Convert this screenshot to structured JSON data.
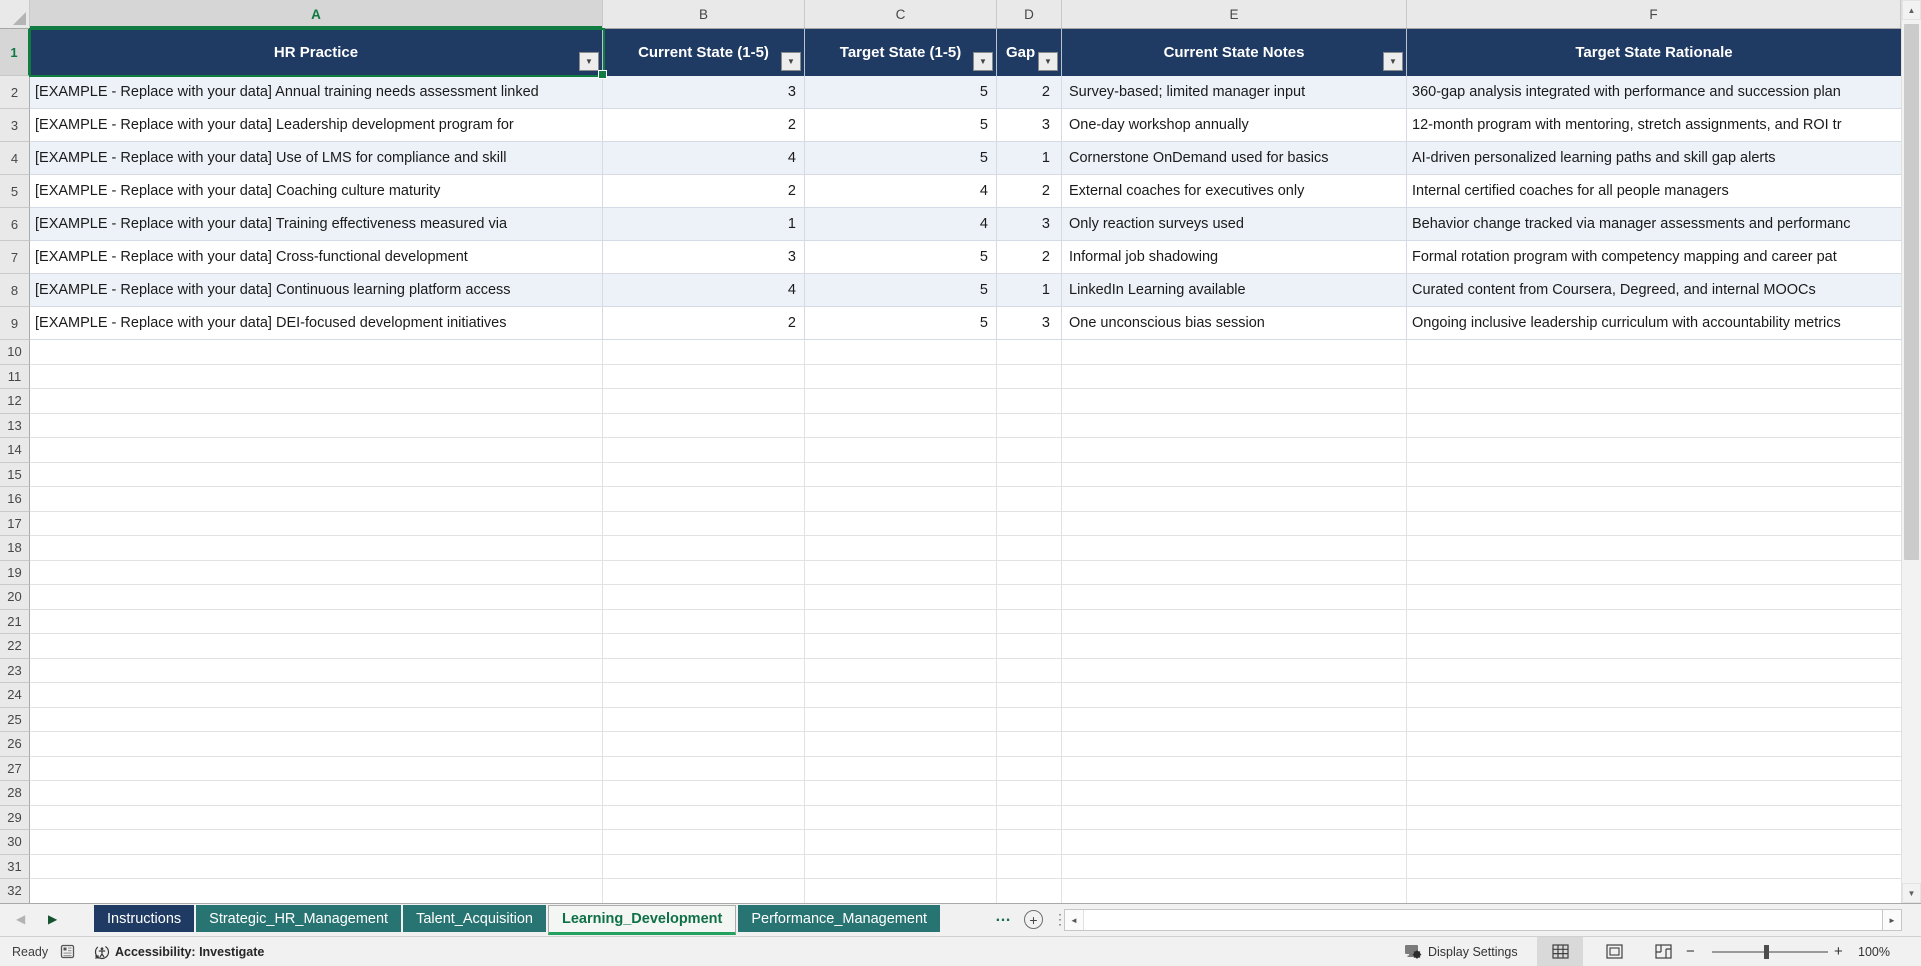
{
  "grid": {
    "column_letters": [
      "A",
      "B",
      "C",
      "D",
      "E",
      "F"
    ],
    "selected_column": "A",
    "selected_row": "1",
    "row_numbers": [
      "1",
      "2",
      "3",
      "4",
      "5",
      "6",
      "7",
      "8",
      "9",
      "10",
      "11",
      "12",
      "13",
      "14",
      "15",
      "16",
      "17",
      "18",
      "19",
      "20",
      "21",
      "22",
      "23",
      "24",
      "25",
      "26",
      "27",
      "28",
      "29",
      "30",
      "31",
      "32"
    ]
  },
  "table": {
    "headers": [
      {
        "label": "HR Practice",
        "filter": true
      },
      {
        "label": "Current State (1-5)",
        "filter": true
      },
      {
        "label": "Target State (1-5)",
        "filter": true
      },
      {
        "label": "Gap",
        "filter": true
      },
      {
        "label": "Current State Notes",
        "filter": true
      },
      {
        "label": "Target State Rationale",
        "filter": false
      }
    ],
    "rows": [
      {
        "practice": "[EXAMPLE - Replace with your data] Annual training needs assessment linked",
        "current": "3",
        "target": "5",
        "gap": "2",
        "notes": "Survey-based; limited manager input",
        "rationale": "360-gap analysis integrated with performance and succession plan"
      },
      {
        "practice": "[EXAMPLE - Replace with your data] Leadership development program for",
        "current": "2",
        "target": "5",
        "gap": "3",
        "notes": "One-day workshop annually",
        "rationale": "12-month program with mentoring, stretch assignments, and ROI tr"
      },
      {
        "practice": "[EXAMPLE - Replace with your data] Use of LMS for compliance and skill",
        "current": "4",
        "target": "5",
        "gap": "1",
        "notes": "Cornerstone OnDemand used for basics",
        "rationale": "AI-driven personalized learning paths and skill gap alerts"
      },
      {
        "practice": "[EXAMPLE - Replace with your data] Coaching culture maturity",
        "current": "2",
        "target": "4",
        "gap": "2",
        "notes": "External coaches for executives only",
        "rationale": "Internal certified coaches for all people managers"
      },
      {
        "practice": "[EXAMPLE - Replace with your data] Training effectiveness measured via",
        "current": "1",
        "target": "4",
        "gap": "3",
        "notes": "Only reaction surveys used",
        "rationale": "Behavior change tracked via manager assessments and performanc"
      },
      {
        "practice": "[EXAMPLE - Replace with your data] Cross-functional development",
        "current": "3",
        "target": "5",
        "gap": "2",
        "notes": "Informal job shadowing",
        "rationale": "Formal rotation program with competency mapping and career pat"
      },
      {
        "practice": "[EXAMPLE - Replace with your data] Continuous learning platform access",
        "current": "4",
        "target": "5",
        "gap": "1",
        "notes": "LinkedIn Learning available",
        "rationale": "Curated content from Coursera, Degreed, and internal MOOCs"
      },
      {
        "practice": "[EXAMPLE - Replace with your data] DEI-focused development initiatives",
        "current": "2",
        "target": "5",
        "gap": "3",
        "notes": "One unconscious bias session",
        "rationale": "Ongoing inclusive leadership curriculum with accountability metrics"
      }
    ]
  },
  "tab_bar": {
    "tabs": [
      {
        "label": "Instructions",
        "style": "navy",
        "active": false
      },
      {
        "label": "Strategic_HR_Management",
        "style": "teal",
        "active": false
      },
      {
        "label": "Talent_Acquisition",
        "style": "teal",
        "active": false
      },
      {
        "label": "Learning_Development",
        "style": "teal",
        "active": true
      },
      {
        "label": "Performance_Management",
        "style": "teal",
        "active": false
      }
    ],
    "overflow_indicator": "…",
    "add_sheet": "+",
    "more_options": "⋮"
  },
  "status_bar": {
    "ready": "Ready",
    "accessibility": "Accessibility: Investigate",
    "display_settings": "Display Settings",
    "zoom_out": "−",
    "zoom_in": "+",
    "zoom_level": "100%"
  },
  "icons": {
    "filter": "▼",
    "nav_left": "◀",
    "nav_right": "▶",
    "scroll_up": "▲",
    "scroll_down": "▼",
    "scroll_left": "◄",
    "scroll_right": "►"
  },
  "colors": {
    "header_navy": "#1F3A63",
    "band_blue": "#EDF2F9",
    "tab_teal": "#287473",
    "selection_green": "#107C41",
    "active_tab_text": "#0F7048"
  }
}
